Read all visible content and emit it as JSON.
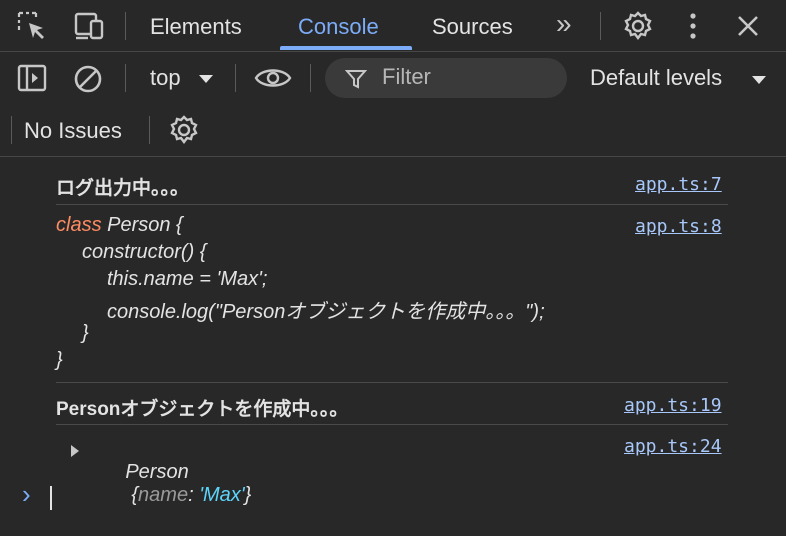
{
  "tabs": {
    "elements": "Elements",
    "console": "Console",
    "sources": "Sources",
    "more": "»"
  },
  "toolbar": {
    "context": "top",
    "filter_placeholder": "Filter",
    "levels": "Default levels"
  },
  "issues": {
    "label": "No Issues"
  },
  "messages": [
    {
      "text": "ログ出力中。。。",
      "source": "app.ts:7"
    },
    {
      "lines": [
        {
          "keyword": "class",
          "text": " Person {"
        },
        {
          "keyword": "",
          "text": "constructor() {"
        },
        {
          "keyword": "",
          "text": "this.name = 'Max';"
        },
        {
          "keyword": "",
          "text": "console.log(\"Personオブジェクトを作成中。。。\");"
        },
        {
          "keyword": "",
          "text": "}"
        },
        {
          "keyword": "",
          "text": "}"
        }
      ],
      "source": "app.ts:8"
    },
    {
      "text": "Personオブジェクトを作成中。。。",
      "source": "app.ts:19"
    },
    {
      "object_name": "Person",
      "open_brace": "{",
      "prop_key": "name",
      "colon": ":",
      "prop_value": "'Max'",
      "close_brace": "}",
      "source": "app.ts:24"
    }
  ],
  "prompt": {
    "symbol": "›"
  },
  "colors": {
    "background": "#282828",
    "accent": "#7cacf8",
    "link": "#a8c7fa",
    "keyword": "#ff8b62",
    "string_value": "#5cd5fb"
  }
}
